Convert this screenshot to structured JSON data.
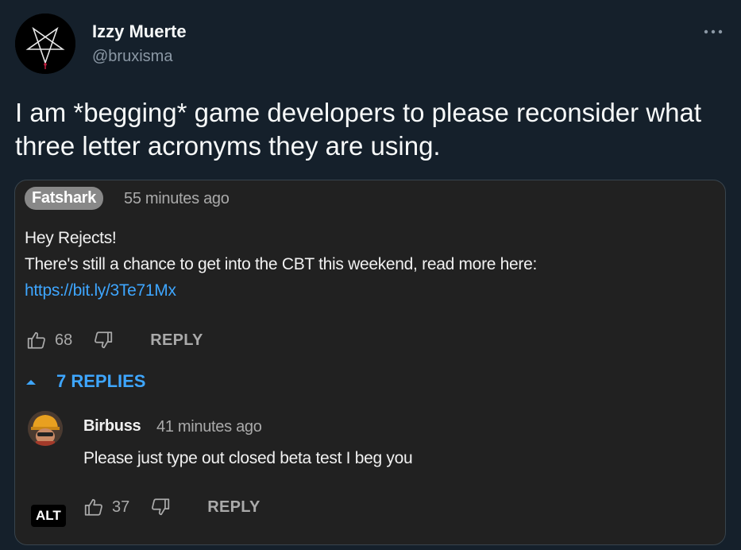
{
  "author": {
    "display_name": "Izzy Muerte",
    "handle": "@bruxisma",
    "avatar_icon": "pentagram-icon"
  },
  "more_icon": "more-horizontal-icon",
  "tweet_text": "I am *begging* game developers to please reconsider what three letter acronyms they are using.",
  "media": {
    "comment": {
      "author": "Fatshark",
      "time": "55 minutes ago",
      "line1": "Hey Rejects!",
      "line2": "There's still a chance to get into the CBT this weekend, read more here:",
      "link": "https://bit.ly/3Te71Mx",
      "likes": "68",
      "reply_label": "REPLY"
    },
    "replies_toggle": "7 REPLIES",
    "reply": {
      "author": "Birbuss",
      "time": "41 minutes ago",
      "text": "Please just type out closed beta test I beg you",
      "likes": "37",
      "reply_label": "REPLY"
    },
    "alt_label": "ALT"
  },
  "colors": {
    "background": "#15202b",
    "link": "#3ea6ff",
    "media_bg": "#212121"
  }
}
